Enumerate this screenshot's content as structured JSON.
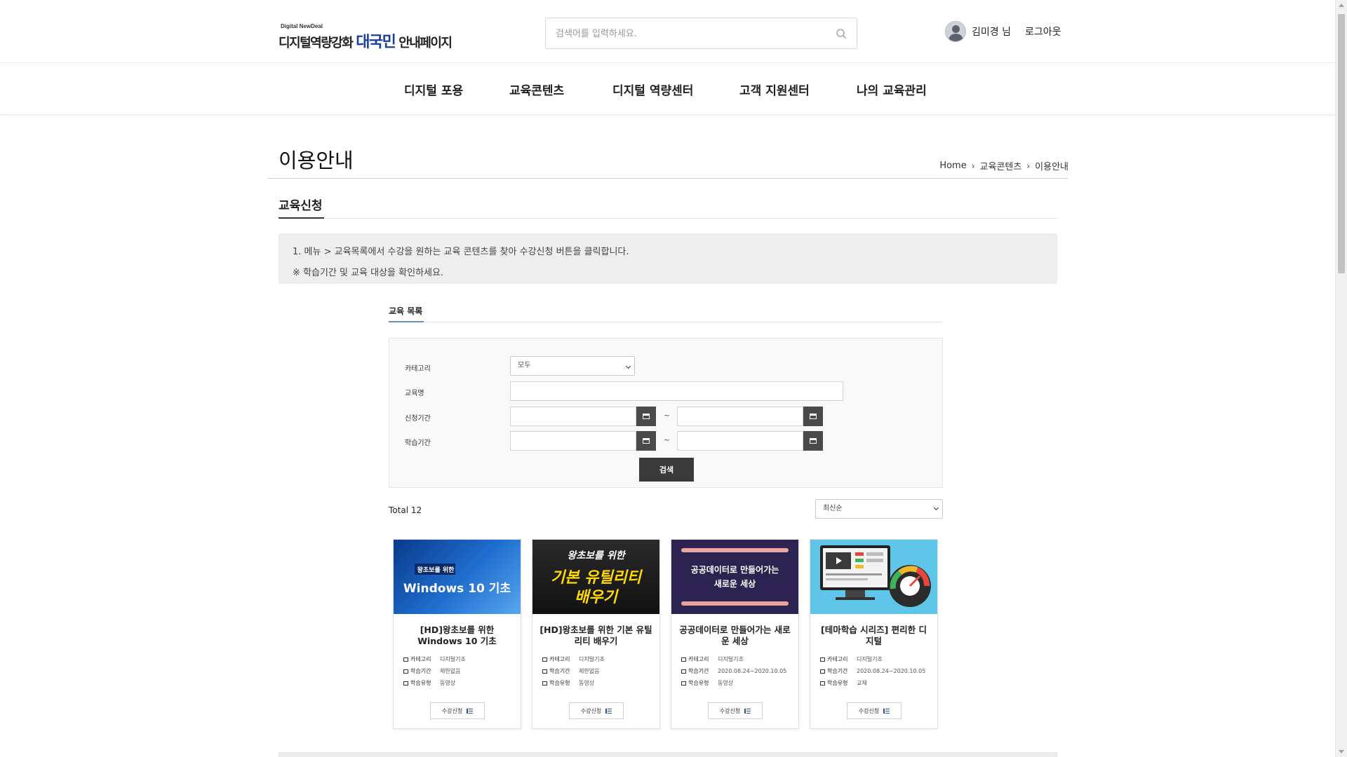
{
  "header": {
    "logo_small": "Digital NewDeal",
    "logo_pre": "디지털역량강화 ",
    "logo_highlight": "대국민",
    "logo_post": " 안내페이지",
    "search_placeholder": "검색어를 입력하세요.",
    "user_name": "김미경 님",
    "logout": "로그아웃"
  },
  "gnb": [
    "디지털 포용",
    "교육콘텐츠",
    "디지털 역량센터",
    "고객 지원센터",
    "나의 교육관리"
  ],
  "page": {
    "title": "이용안내",
    "breadcrumb": [
      "Home",
      "교육콘텐츠",
      "이용안내"
    ],
    "subtitle": "교육신청",
    "notice": [
      "1. 메뉴 > 교육목록에서 수강을 원하는 교육 콘텐츠를 찾아 수강신청 버튼을 클릭합니다.",
      "※ 학습기간 및 교육 대상을 확인하세요."
    ]
  },
  "edu": {
    "section_title": "교육 목록",
    "labels": {
      "category": "카테고리",
      "name": "교육명",
      "apply_period": "신청기간",
      "study_period": "학습기간"
    },
    "category_value": "모두",
    "tilde": "~",
    "search_button": "검색",
    "total": "Total 12",
    "sort_value": "최신순",
    "meta_keys": [
      "카테고리",
      "학습기간",
      "학습유형"
    ],
    "apply_label": "수강신청",
    "cards": [
      {
        "thumb_small": "왕초보를 위한",
        "thumb_main": "Windows 10 기초",
        "title": "[HD]왕초보를 위한 Windows 10 기초",
        "category": "디지털기초",
        "period": "제한없음",
        "type": "동영상"
      },
      {
        "thumb_small": "왕초보를 위한",
        "thumb_main1": "기본 유틸리티",
        "thumb_main2": "배우기",
        "title": "[HD]왕초보를 위한 기본 유틸리티 배우기",
        "category": "디지털기초",
        "period": "제한없음",
        "type": "동영상"
      },
      {
        "thumb_main1": "공공데이터로 만들어가는",
        "thumb_main2": "새로운 세상",
        "title": "공공데이터로 만들어가는 새로운 세상",
        "category": "디지털기초",
        "period": "2020.08.24~2020.10.05",
        "type": "동영상"
      },
      {
        "title": "[테마학습 시리즈] 편리한 디지털",
        "category": "디지털기초",
        "period": "2020.08.24~2020.10.05",
        "type": "교재"
      }
    ]
  }
}
